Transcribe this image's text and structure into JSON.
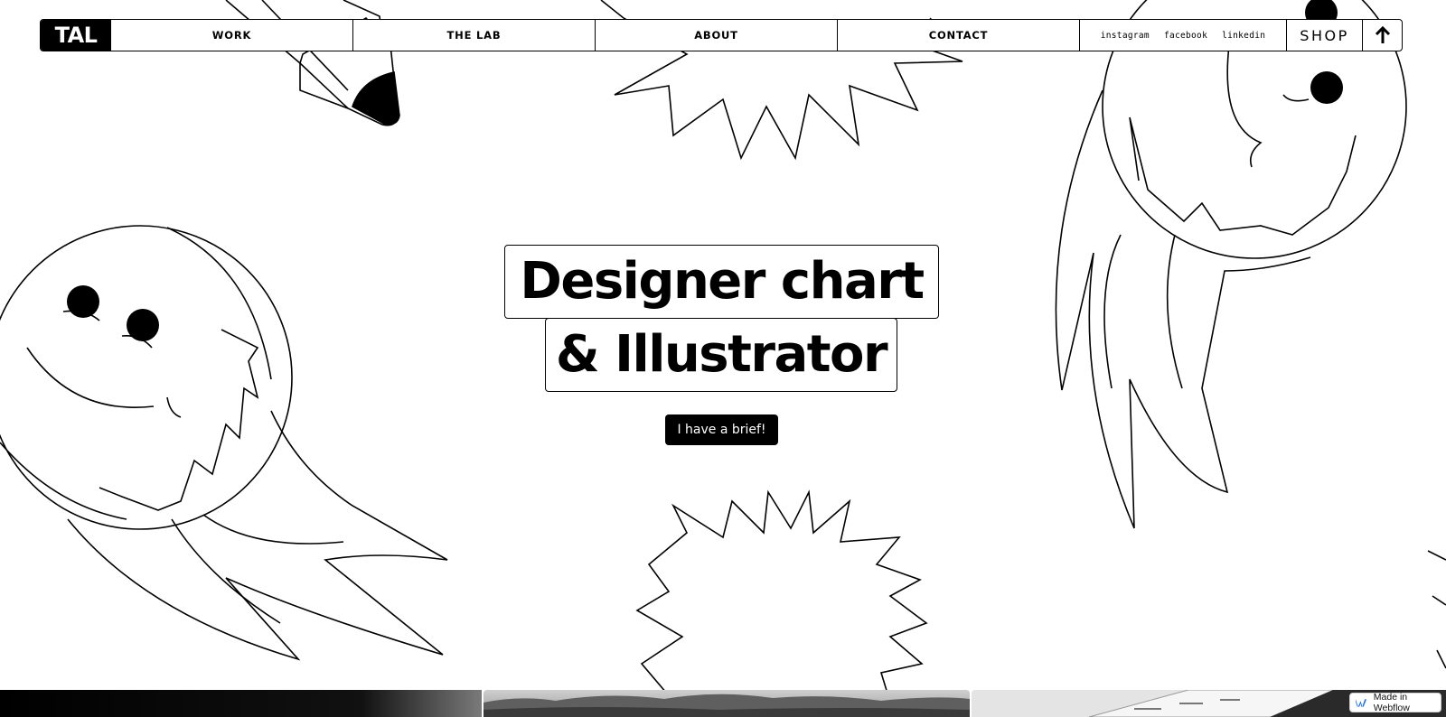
{
  "nav": {
    "logo": "TAL",
    "links": [
      {
        "label": "WORK"
      },
      {
        "label": "THE LAB"
      },
      {
        "label": "ABOUT"
      },
      {
        "label": "CONTACT"
      }
    ],
    "social": [
      {
        "label": "instagram"
      },
      {
        "label": "facebook"
      },
      {
        "label": "linkedin"
      }
    ],
    "shop_label": "SHOP",
    "up_icon": "arrow-up-icon"
  },
  "hero": {
    "line1": "Designer chart",
    "line2": "& Illustrator",
    "cta_label": "I have a brief!"
  },
  "badge": {
    "label": "Made in Webflow",
    "icon": "webflow-icon"
  },
  "colors": {
    "ink": "#000000",
    "paper": "#ffffff"
  }
}
